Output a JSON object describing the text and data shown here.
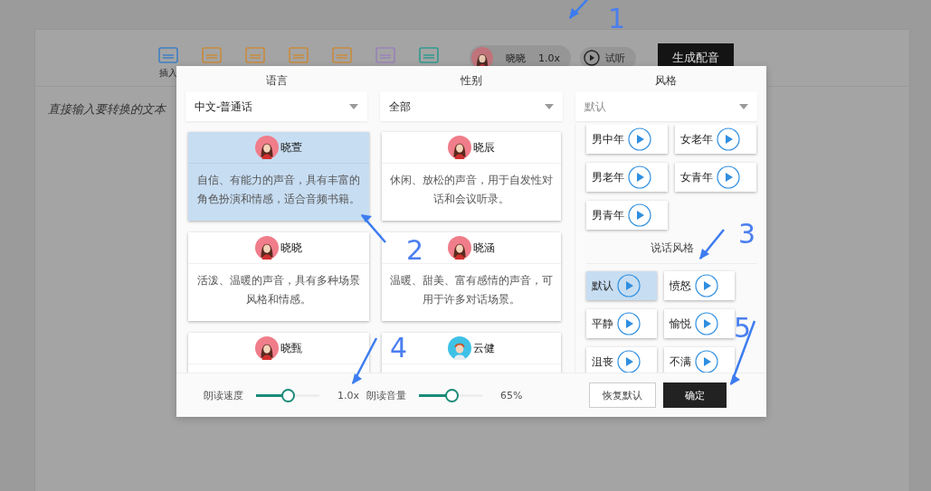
{
  "toolbar": {
    "insert_label": "插入",
    "voice": {
      "name": "晓晓",
      "speed": "1.0x"
    },
    "preview": "试听",
    "generate": "生成配音"
  },
  "editor": {
    "placeholder": "直接输入要转换的文本"
  },
  "dialog": {
    "filters": [
      {
        "label": "语言",
        "value": "中文-普通话"
      },
      {
        "label": "性别",
        "value": "全部"
      },
      {
        "label": "风格",
        "placeholder": "默认"
      }
    ],
    "voices": [
      {
        "name": "晓萱",
        "kind": "female",
        "selected": true,
        "description": "自信、有能力的声音，具有丰富的角色扮演和情感，适合音频书籍。"
      },
      {
        "name": "晓辰",
        "kind": "female",
        "selected": false,
        "description": "休闲、放松的声音，用于自发性对话和会议听录。"
      },
      {
        "name": "晓晓",
        "kind": "female",
        "selected": false,
        "description": "活泼、温暖的声音，具有多种场景风格和情感。"
      },
      {
        "name": "晓涵",
        "kind": "female",
        "selected": false,
        "description": "温暖、甜美、富有感情的声音，可用于许多对话场景。"
      },
      {
        "name": "晓甄",
        "kind": "female",
        "selected": false
      },
      {
        "name": "云健",
        "kind": "male",
        "selected": false
      }
    ],
    "roles": [
      {
        "label": "男中年",
        "selected": false
      },
      {
        "label": "女老年",
        "selected": false
      },
      {
        "label": "男老年",
        "selected": false
      },
      {
        "label": "女青年",
        "selected": false
      },
      {
        "label": "男青年",
        "selected": false
      }
    ],
    "speaking_style_title": "说话风格",
    "styles": [
      {
        "label": "默认",
        "selected": true
      },
      {
        "label": "愤怒",
        "selected": false
      },
      {
        "label": "平静",
        "selected": false
      },
      {
        "label": "愉悦",
        "selected": false
      },
      {
        "label": "沮丧",
        "selected": false
      },
      {
        "label": "不满",
        "selected": false
      }
    ],
    "sliders": [
      {
        "label": "朗读速度",
        "level": 0.5,
        "reading": "1.0x"
      },
      {
        "label": "朗读音量",
        "level": 0.51,
        "reading": "65%"
      }
    ],
    "buttons": [
      {
        "label": "恢复默认",
        "kind": "secondary"
      },
      {
        "label": "确定",
        "kind": "primary"
      }
    ]
  },
  "annotations": [
    "1",
    "2",
    "3",
    "4",
    "5"
  ]
}
